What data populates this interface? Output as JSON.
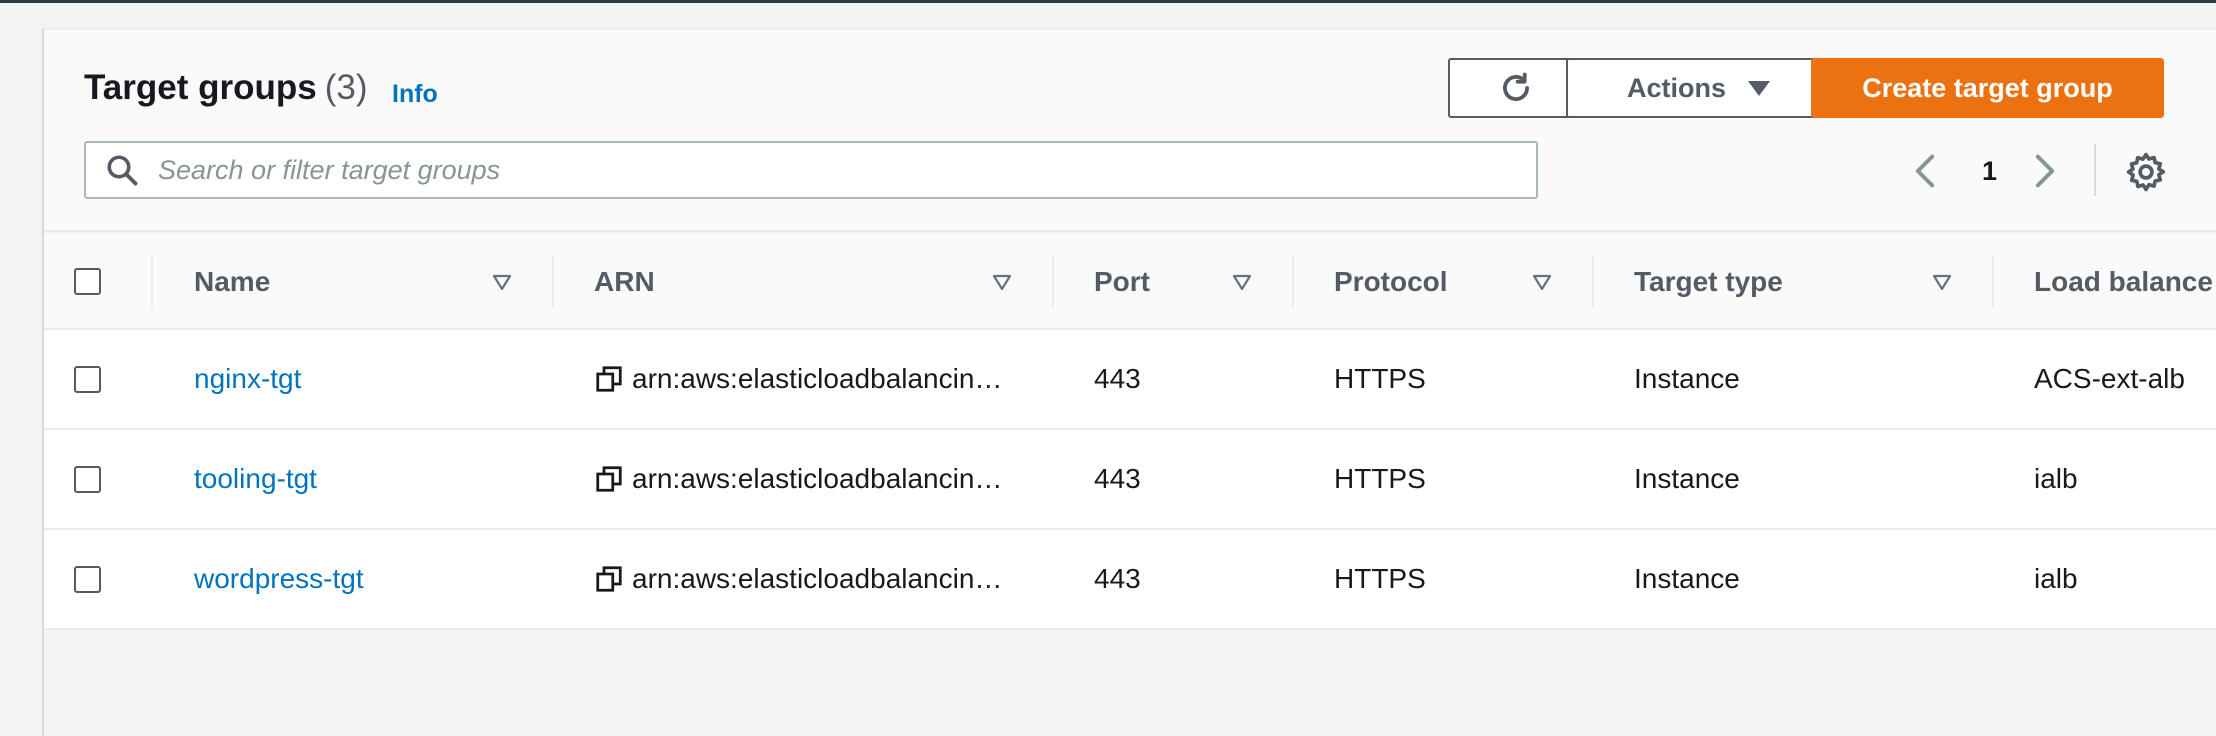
{
  "header": {
    "title": "Target groups",
    "count": "(3)",
    "info_label": "Info",
    "actions_label": "Actions",
    "create_label": "Create target group",
    "search_placeholder": "Search or filter target groups",
    "page_number": "1"
  },
  "table": {
    "columns": [
      "Name",
      "ARN",
      "Port",
      "Protocol",
      "Target type",
      "Load balance"
    ],
    "rows": [
      {
        "name": "nginx-tgt",
        "arn": "arn:aws:elasticloadbalancin…",
        "port": "443",
        "protocol": "HTTPS",
        "target_type": "Instance",
        "load_balancer": "ACS-ext-alb"
      },
      {
        "name": "tooling-tgt",
        "arn": "arn:aws:elasticloadbalancin…",
        "port": "443",
        "protocol": "HTTPS",
        "target_type": "Instance",
        "load_balancer": "ialb"
      },
      {
        "name": "wordpress-tgt",
        "arn": "arn:aws:elasticloadbalancin…",
        "port": "443",
        "protocol": "HTTPS",
        "target_type": "Instance",
        "load_balancer": "ialb"
      }
    ]
  },
  "icons": {
    "refresh": "refresh-icon",
    "caret": "caret-down-icon",
    "search": "search-icon",
    "prev": "chevron-left-icon",
    "next": "chevron-right-icon",
    "settings": "gear-icon",
    "sort": "sort-triangle-icon",
    "copy": "copy-icon"
  },
  "colors": {
    "primary_button": "#ec7211",
    "link": "#0073bb",
    "text": "#16191f",
    "muted": "#545b64"
  }
}
